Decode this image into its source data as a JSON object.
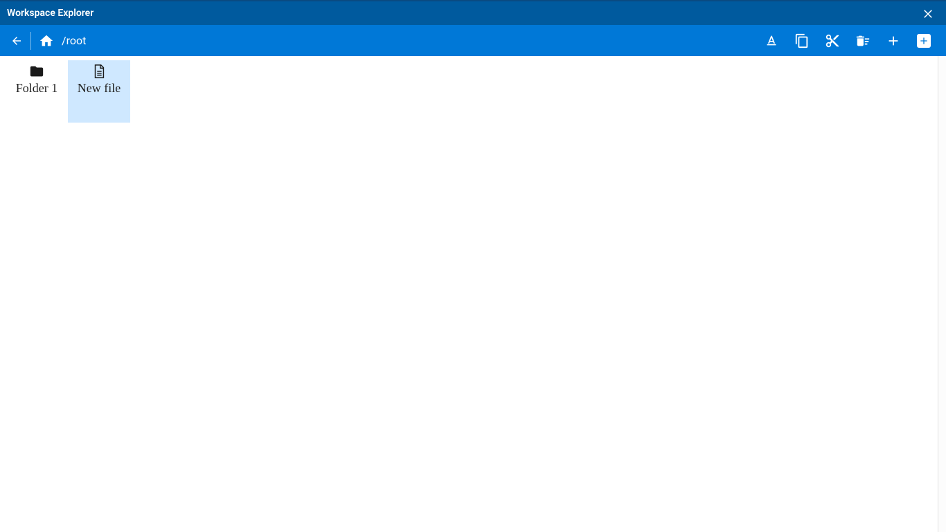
{
  "window": {
    "title": "Workspace Explorer"
  },
  "toolbar": {
    "path": "/root"
  },
  "items": [
    {
      "label": "Folder 1",
      "type": "folder",
      "selected": false
    },
    {
      "label": "New file",
      "type": "file",
      "selected": true
    }
  ]
}
